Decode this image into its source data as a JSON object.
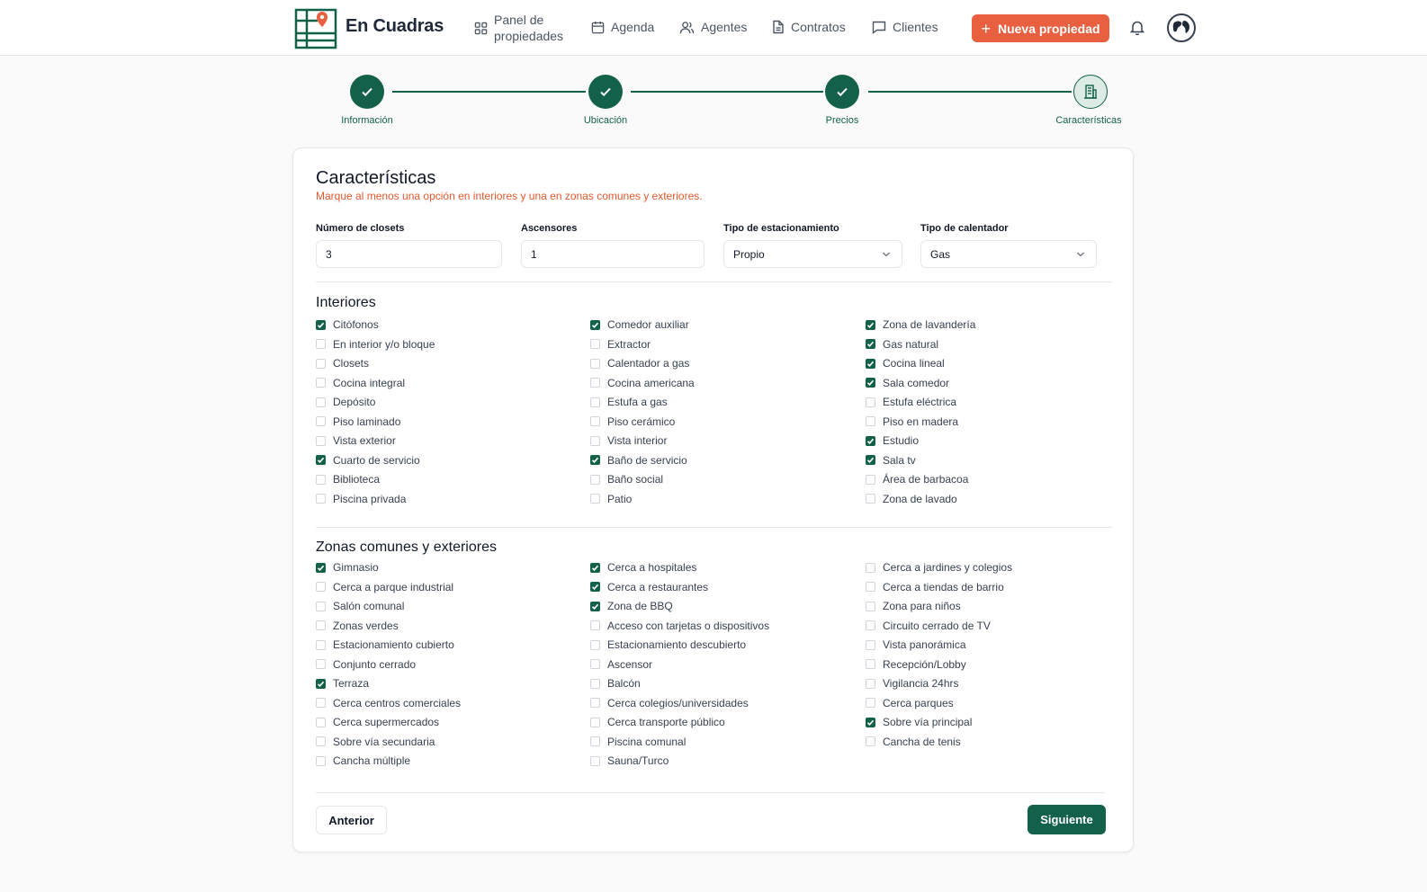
{
  "app": {
    "brand": "En Cuadras"
  },
  "nav": {
    "panel": "Panel de propiedades",
    "agenda": "Agenda",
    "agentes": "Agentes",
    "contratos": "Contratos",
    "clientes": "Clientes",
    "new_property": "Nueva propiedad"
  },
  "colors": {
    "primary": "#14614a",
    "accent": "#e8603f",
    "warning_text": "#e0592f"
  },
  "steps": [
    {
      "label": "Información",
      "state": "done",
      "icon": "check-icon"
    },
    {
      "label": "Ubicación",
      "state": "done",
      "icon": "check-icon"
    },
    {
      "label": "Precios",
      "state": "done",
      "icon": "check-icon"
    },
    {
      "label": "Características",
      "state": "current",
      "icon": "building-icon"
    }
  ],
  "form": {
    "title": "Características",
    "subtitle": "Marque al menos una opción en interiores y una en zonas comunes y exteriores.",
    "closets_label": "Número de closets",
    "closets_value": "3",
    "elevators_label": "Ascensores",
    "elevators_value": "1",
    "parking_label": "Tipo de estacionamiento",
    "parking_value": "Propio",
    "heater_label": "Tipo de calentador",
    "heater_value": "Gas"
  },
  "interiores": {
    "title": "Interiores",
    "columns": [
      [
        {
          "label": "Citófonos",
          "checked": true
        },
        {
          "label": "En interior y/o bloque",
          "checked": false
        },
        {
          "label": "Closets",
          "checked": false
        },
        {
          "label": "Cocina integral",
          "checked": false
        },
        {
          "label": "Depósito",
          "checked": false
        },
        {
          "label": "Piso laminado",
          "checked": false
        },
        {
          "label": "Vista exterior",
          "checked": false
        },
        {
          "label": "Cuarto de servicio",
          "checked": true
        },
        {
          "label": "Biblioteca",
          "checked": false
        },
        {
          "label": "Piscina privada",
          "checked": false
        }
      ],
      [
        {
          "label": "Comedor auxiliar",
          "checked": true
        },
        {
          "label": "Extractor",
          "checked": false
        },
        {
          "label": "Calentador a gas",
          "checked": false
        },
        {
          "label": "Cocina americana",
          "checked": false
        },
        {
          "label": "Estufa a gas",
          "checked": false
        },
        {
          "label": "Piso cerámico",
          "checked": false
        },
        {
          "label": "Vista interior",
          "checked": false
        },
        {
          "label": "Baño de servicio",
          "checked": true
        },
        {
          "label": "Baño social",
          "checked": false
        },
        {
          "label": "Patio",
          "checked": false
        }
      ],
      [
        {
          "label": "Zona de lavandería",
          "checked": true
        },
        {
          "label": "Gas natural",
          "checked": true
        },
        {
          "label": "Cocina lineal",
          "checked": true
        },
        {
          "label": "Sala comedor",
          "checked": true
        },
        {
          "label": "Estufa eléctrica",
          "checked": false
        },
        {
          "label": "Piso en madera",
          "checked": false
        },
        {
          "label": "Estudio",
          "checked": true
        },
        {
          "label": "Sala tv",
          "checked": true
        },
        {
          "label": "Área de barbacoa",
          "checked": false
        },
        {
          "label": "Zona de lavado",
          "checked": false
        }
      ]
    ]
  },
  "zonas": {
    "title": "Zonas comunes y exteriores",
    "columns": [
      [
        {
          "label": "Gimnasio",
          "checked": true
        },
        {
          "label": "Cerca a parque industrial",
          "checked": false
        },
        {
          "label": "Salón comunal",
          "checked": false
        },
        {
          "label": "Zonas verdes",
          "checked": false
        },
        {
          "label": "Estacionamiento cubierto",
          "checked": false
        },
        {
          "label": "Conjunto cerrado",
          "checked": false
        },
        {
          "label": "Terraza",
          "checked": true
        },
        {
          "label": "Cerca centros comerciales",
          "checked": false
        },
        {
          "label": "Cerca supermercados",
          "checked": false
        },
        {
          "label": "Sobre vía secundaria",
          "checked": false
        },
        {
          "label": "Cancha múltiple",
          "checked": false
        }
      ],
      [
        {
          "label": "Cerca a hospitales",
          "checked": true
        },
        {
          "label": "Cerca a restaurantes",
          "checked": true
        },
        {
          "label": "Zona de BBQ",
          "checked": true
        },
        {
          "label": "Acceso con tarjetas o dispositivos",
          "checked": false
        },
        {
          "label": "Estacionamiento descubierto",
          "checked": false
        },
        {
          "label": "Ascensor",
          "checked": false
        },
        {
          "label": "Balcón",
          "checked": false
        },
        {
          "label": "Cerca colegios/universidades",
          "checked": false
        },
        {
          "label": "Cerca transporte público",
          "checked": false
        },
        {
          "label": "Piscina comunal",
          "checked": false
        },
        {
          "label": "Sauna/Turco",
          "checked": false
        }
      ],
      [
        {
          "label": "Cerca a jardines y colegios",
          "checked": false
        },
        {
          "label": "Cerca a tiendas de barrio",
          "checked": false
        },
        {
          "label": "Zona para niños",
          "checked": false
        },
        {
          "label": "Circuito cerrado de TV",
          "checked": false
        },
        {
          "label": "Vista panorámica",
          "checked": false
        },
        {
          "label": "Recepción/Lobby",
          "checked": false
        },
        {
          "label": "Vigilancia 24hrs",
          "checked": false
        },
        {
          "label": "Cerca parques",
          "checked": false
        },
        {
          "label": "Sobre vía principal",
          "checked": true
        },
        {
          "label": "Cancha de tenis",
          "checked": false
        }
      ]
    ]
  },
  "actions": {
    "prev": "Anterior",
    "next": "Siguiente"
  }
}
